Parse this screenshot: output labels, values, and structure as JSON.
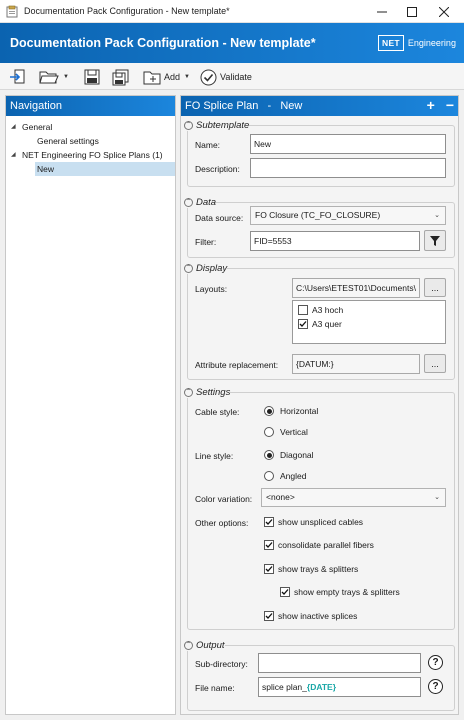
{
  "window": {
    "title": "Documentation Pack Configuration - New template*",
    "banner_title": "Documentation Pack Configuration - New template*",
    "logo_box": "NET",
    "logo_word": "Engineering"
  },
  "toolbar": {
    "add_label": "Add",
    "validate_label": "Validate"
  },
  "navigation": {
    "header": "Navigation",
    "tree": [
      {
        "label": "General",
        "level": 0
      },
      {
        "label": "General settings",
        "level": 1
      },
      {
        "label": "NET Engineering FO Splice Plans (1)",
        "level": 0
      },
      {
        "label": "New",
        "level": 1,
        "selected": true
      }
    ]
  },
  "panel": {
    "header": "FO Splice Plan   -   New",
    "add_icon": "plus-icon",
    "remove_icon": "minus-icon"
  },
  "subtemplate": {
    "title": "Subtemplate",
    "name_label": "Name:",
    "name_value": "New",
    "description_label": "Description:",
    "description_value": ""
  },
  "data_group": {
    "title": "Data",
    "source_label": "Data source:",
    "source_value": "FO Closure (TC_FO_CLOSURE)",
    "filter_label": "Filter:",
    "filter_value": "FID=5553"
  },
  "display": {
    "title": "Display",
    "layouts_label": "Layouts:",
    "layouts_path": "C:\\Users\\ETEST01\\Documents\\",
    "browse_label": "...",
    "layouts": [
      {
        "label": "A3 hoch",
        "checked": false
      },
      {
        "label": "A3 quer",
        "checked": true
      }
    ],
    "attr_label": "Attribute replacement:",
    "attr_value": "{DATUM:}"
  },
  "settings": {
    "title": "Settings",
    "cable_label": "Cable style:",
    "cable_options": [
      {
        "label": "Horizontal",
        "selected": true
      },
      {
        "label": "Vertical",
        "selected": false
      }
    ],
    "line_label": "Line style:",
    "line_options": [
      {
        "label": "Diagonal",
        "selected": true
      },
      {
        "label": "Angled",
        "selected": false
      }
    ],
    "color_label": "Color variation:",
    "color_value": "<none>",
    "other_label": "Other options:",
    "options": [
      {
        "label": "show unspliced cables",
        "checked": true
      },
      {
        "label": "consolidate parallel fibers",
        "checked": true
      },
      {
        "label": "show trays & splitters",
        "checked": true
      },
      {
        "label": "show empty trays & splitters",
        "checked": true
      },
      {
        "label": "show inactive splices",
        "checked": true
      }
    ]
  },
  "output": {
    "title": "Output",
    "subdir_label": "Sub-directory:",
    "subdir_value": "",
    "filename_label": "File name:",
    "filename_prefix": "splice plan_",
    "filename_token": "{DATE}",
    "help_glyph": "?"
  }
}
